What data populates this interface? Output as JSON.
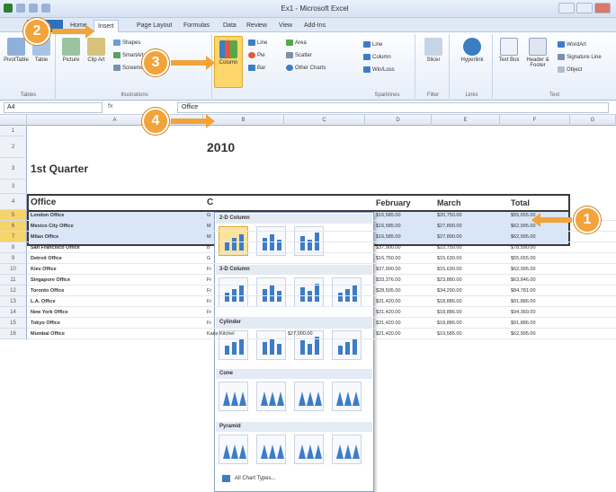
{
  "window": {
    "title": "Ex1 - Microsoft Excel"
  },
  "tabs": [
    "File",
    "Home",
    "Insert",
    "Page Layout",
    "Formulas",
    "Data",
    "Review",
    "View",
    "Add-Ins"
  ],
  "ribbon": {
    "groups": {
      "tables": "Tables",
      "illustrations": "Illustrations",
      "sparklines": "Sparklines",
      "filter": "Filter",
      "links": "Links",
      "text": "Text"
    },
    "buttons": {
      "pivot_table": "PivotTable",
      "table": "Table",
      "picture": "Picture",
      "clip_art": "Clip Art",
      "shapes": "Shapes",
      "smart_art": "SmartArt",
      "screenshot": "Screenshot",
      "column": "Column",
      "line": "Line",
      "pie": "Pie",
      "bar": "Bar",
      "area": "Area",
      "scatter": "Scatter",
      "other_charts": "Other Charts",
      "sl_line": "Line",
      "sl_column": "Column",
      "win_loss": "Win/Loss",
      "slicer": "Slicer",
      "hyperlink": "Hyperlink",
      "text_box": "Text Box",
      "header_footer": "Header & Footer",
      "wordart": "WordArt",
      "signature_line": "Signature Line",
      "object": "Object"
    }
  },
  "formula_bar": {
    "name_box": "A4",
    "fx": "fx",
    "content": "Office"
  },
  "columns": [
    "A",
    "B",
    "C",
    "D",
    "E",
    "F",
    "G"
  ],
  "sheet": {
    "title_fragment": "2010",
    "subtitle": "1st Quarter",
    "headers": {
      "office": "Office",
      "c": "C",
      "february": "February",
      "march": "March",
      "total": "Total"
    },
    "rows": [
      {
        "r": "5",
        "office": "London Office",
        "c": "G",
        "feb": "$16,585.00",
        "mar": "$20,750.00",
        "total": "$55,655.00"
      },
      {
        "r": "6",
        "office": "Mexico City Office",
        "c": "M",
        "feb": "$16,585.00",
        "mar": "$27,890.00",
        "total": "$62,995.00"
      },
      {
        "r": "7",
        "office": "Milan Office",
        "c": "M",
        "feb": "$16,585.00",
        "mar": "$27,890.00",
        "total": "$62,995.00"
      },
      {
        "r": "8",
        "office": "San Francisco Office",
        "c": "B",
        "feb": "$37,900.00",
        "mar": "$22,750.00",
        "total": "$78,590.00"
      },
      {
        "r": "9",
        "office": "Detroit Office",
        "c": "G",
        "feb": "$16,750.00",
        "mar": "$15,630.00",
        "total": "$55,655.00"
      },
      {
        "r": "10",
        "office": "Kiev Office",
        "c": "Fr",
        "feb": "$37,900.00",
        "mar": "$15,630.00",
        "total": "$62,995.00"
      },
      {
        "r": "11",
        "office": "Singapore Office",
        "c": "Fr",
        "feb": "$33,376.00",
        "mar": "$23,880.00",
        "total": "$63,846.00"
      },
      {
        "r": "12",
        "office": "Toronto Office",
        "c": "Fr",
        "feb": "$28,505.00",
        "mar": "$34,290.00",
        "total": "$84,781.00"
      },
      {
        "r": "13",
        "office": "L.A. Office",
        "c": "Fr",
        "feb": "$31,420.00",
        "mar": "$18,886.00",
        "total": "$91,886.00"
      },
      {
        "r": "14",
        "office": "New York Office",
        "c": "Fr",
        "feb": "$31,420.00",
        "mar": "$18,886.00",
        "total": "$94,360.00"
      },
      {
        "r": "15",
        "office": "Tokyo Office",
        "c": "Fr",
        "feb": "$31,420.00",
        "mar": "$18,886.00",
        "total": "$91,886.00"
      },
      {
        "r": "16",
        "office": "Mumbai Office",
        "c": "Katie Kitchel",
        "d": "$27,000.00",
        "feb": "$21,420.00",
        "mar": "$19,585.00",
        "total": "$62,995.00"
      }
    ]
  },
  "dropdown": {
    "sections": [
      "2-D Column",
      "3-D Column",
      "Cylinder",
      "Cone",
      "Pyramid"
    ],
    "all_chart_types": "All Chart Types..."
  },
  "callouts": [
    "2",
    "3",
    "4",
    "1"
  ],
  "colors": {
    "callout": "#f2a33a",
    "selection": "#a8c8ee",
    "highlight": "#fbe39a"
  }
}
